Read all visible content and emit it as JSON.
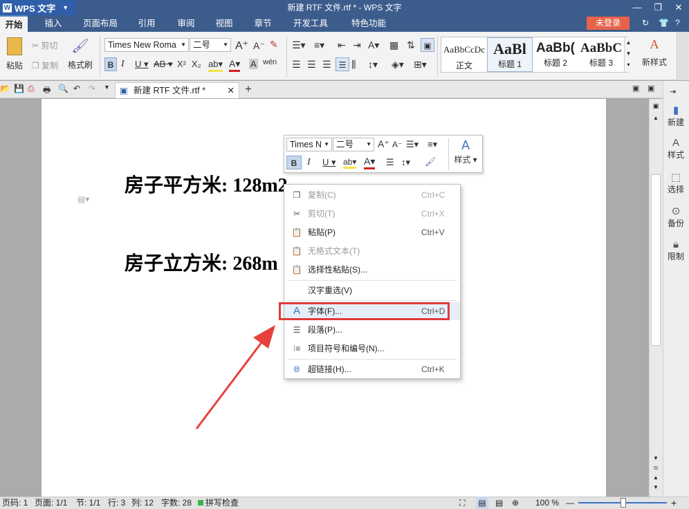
{
  "app": {
    "menu_label": "WPS 文字",
    "window_title": "新建 RTF 文件.rtf * - WPS 文字"
  },
  "menu_tabs": [
    "开始",
    "插入",
    "页面布局",
    "引用",
    "审阅",
    "视图",
    "章节",
    "开发工具",
    "特色功能"
  ],
  "login_label": "未登录",
  "ribbon": {
    "paste": "粘贴",
    "cut": "剪切",
    "copy": "复制",
    "format_painter": "格式刷",
    "font_name": "Times New Roma",
    "font_size": "二号",
    "styles": [
      {
        "preview": "AaBbCcDc",
        "name": "正文"
      },
      {
        "preview": "AaBl",
        "name": "标题 1"
      },
      {
        "preview": "AaBb(",
        "name": "标题 2"
      },
      {
        "preview": "AaBbC",
        "name": "标题 3"
      }
    ],
    "new_style": "新样式"
  },
  "doc_tab": "新建 RTF 文件.rtf *",
  "document": {
    "line1": "房子平方米: 128m2",
    "line2": "房子立方米: 268m"
  },
  "mini_toolbar": {
    "font_name": "Times N",
    "font_size": "二号",
    "style_label": "样式"
  },
  "context_menu": {
    "items": [
      {
        "label": "复制(C)",
        "shortcut": "Ctrl+C",
        "disabled": true
      },
      {
        "label": "剪切(T)",
        "shortcut": "Ctrl+X",
        "disabled": true
      },
      {
        "label": "粘贴(P)",
        "shortcut": "Ctrl+V",
        "disabled": false
      },
      {
        "label": "无格式文本(T)",
        "shortcut": "",
        "disabled": true
      },
      {
        "label": "选择性粘贴(S)...",
        "shortcut": "",
        "disabled": false
      },
      {
        "label": "汉字重选(V)",
        "shortcut": "",
        "disabled": false
      },
      {
        "label": "字体(F)...",
        "shortcut": "Ctrl+D",
        "disabled": false
      },
      {
        "label": "段落(P)...",
        "shortcut": "",
        "disabled": false
      },
      {
        "label": "项目符号和编号(N)...",
        "shortcut": "",
        "disabled": false
      },
      {
        "label": "超链接(H)...",
        "shortcut": "Ctrl+K",
        "disabled": false
      }
    ]
  },
  "sidebar": [
    "新建",
    "样式",
    "选择",
    "备份",
    "限制"
  ],
  "status": {
    "page_num": "页码: 1",
    "pages": "页面: 1/1",
    "section": "节: 1/1",
    "row": "行: 3",
    "col": "列: 12",
    "word_count": "字数: 28",
    "spell_check": "拼写检查",
    "zoom": "100 %"
  },
  "colors": {
    "title_bar": "#3c5d8c",
    "highlight_box": "#e03a3a",
    "arrow": "#e8403c",
    "login_button": "#e8634a"
  }
}
